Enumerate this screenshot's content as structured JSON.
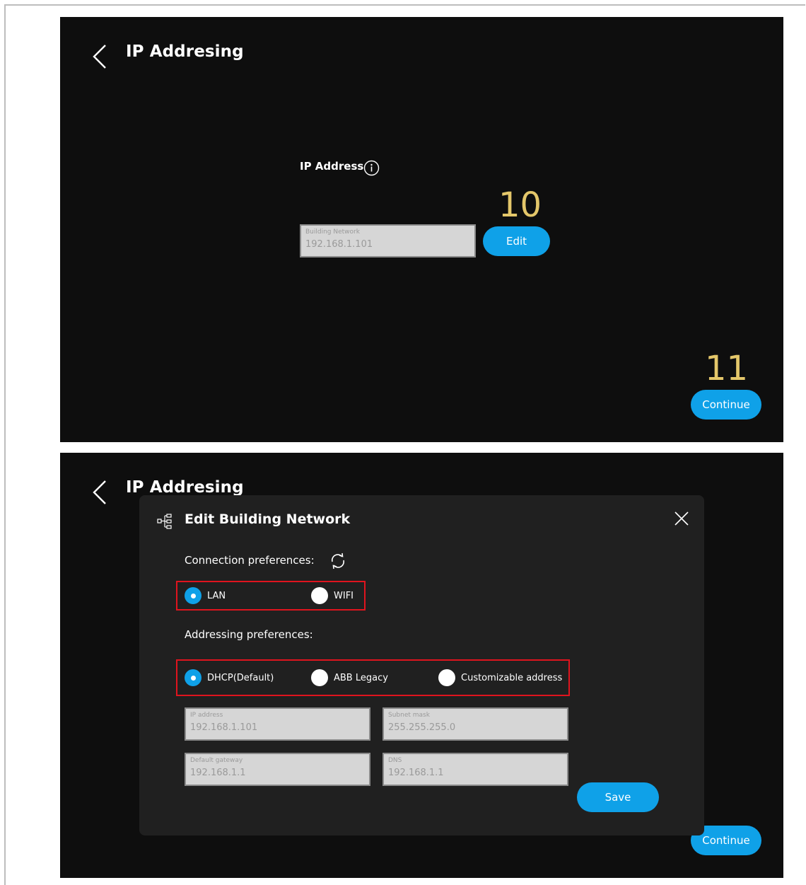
{
  "screen1": {
    "title": "IP Addresing",
    "ip_label": "IP Address",
    "network_field": {
      "label": "Building Network",
      "value": "192.168.1.101"
    },
    "edit_button": "Edit",
    "continue_button": "Continue",
    "annotations": {
      "edit_step": "10",
      "continue_step": "11"
    }
  },
  "screen2": {
    "title": "IP Addresing",
    "continue_button": "Continue",
    "modal": {
      "title": "Edit Building Network",
      "connection_label": "Connection preferences:",
      "connection_options": [
        {
          "label": "LAN",
          "selected": true
        },
        {
          "label": "WIFI",
          "selected": false
        }
      ],
      "addressing_label": "Addressing preferences:",
      "addressing_options": [
        {
          "label": "DHCP(Default)",
          "selected": true
        },
        {
          "label": "ABB Legacy",
          "selected": false
        },
        {
          "label": "Customizable address",
          "selected": false
        }
      ],
      "fields": {
        "ip_address": {
          "label": "IP address",
          "value": "192.168.1.101"
        },
        "subnet_mask": {
          "label": "Subnet mask",
          "value": "255.255.255.0"
        },
        "default_gateway": {
          "label": "Default gateway",
          "value": "192.168.1.1"
        },
        "dns": {
          "label": "DNS",
          "value": "192.168.1.1"
        }
      },
      "save_button": "Save"
    }
  },
  "icons": [
    "back-icon",
    "info-icon",
    "network-icon",
    "close-icon",
    "sync-icon"
  ],
  "colors": {
    "accent": "#0fa1e8",
    "annotation": "#e4c76a",
    "highlight_box": "#e0141e",
    "screen_bg": "#0e0e0e",
    "modal_bg": "#202020"
  }
}
